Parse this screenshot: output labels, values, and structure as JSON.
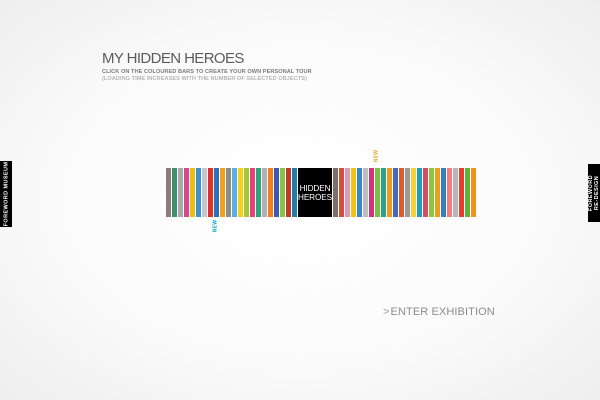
{
  "header": {
    "title": "MY HIDDEN HEROES",
    "subtitle": "CLICK ON THE COLOURED BARS TO CREATE YOUR OWN PERSONAL TOUR",
    "note": "(LOADING TIME INCREASES WITH THE NUMBER OF SELECTED OBJECTS)"
  },
  "side_tabs": {
    "left": "FOREWORD MUSEUM",
    "right": "FOREWORD\nRE-DESIGN"
  },
  "barcode": {
    "center_line1": "HIDDEN",
    "center_line2": "HEROES",
    "left_bars": [
      "#8a7c76",
      "#3f8f6e",
      "#a9a9a9",
      "#d24b8c",
      "#e8bf16",
      "#3f8fcf",
      "#c7c7c7",
      "#e0302a",
      "#2f6fb8",
      "#f0a11e",
      "#8c8c8c",
      "#5aaee0",
      "#f2d21a",
      "#a4c83a",
      "#e3457b",
      "#2ea47d",
      "#b0b0b0",
      "#f07e22",
      "#3a5bab",
      "#87c447",
      "#c0392b",
      "#1f7fa8"
    ],
    "right_bars": [
      "#7a6f6a",
      "#d94b3a",
      "#e09ab8",
      "#f2c414",
      "#3a86c9",
      "#bdbdbd",
      "#d7307f",
      "#7dbf3f",
      "#2f9f8f",
      "#ef9a1c",
      "#4a6ab0",
      "#e15a2a",
      "#9a9a9a",
      "#f4d23b",
      "#1f9fb7",
      "#d64a6a",
      "#8ec641",
      "#e5a31f",
      "#3d7cc1",
      "#f07c80",
      "#b7b7b7",
      "#e63c2f",
      "#5fb043",
      "#f0931c"
    ]
  },
  "new_tags": {
    "top": "NEW",
    "bottom": "NEW"
  },
  "enter": {
    "arrow": ">",
    "label": "ENTER EXHIBITION"
  }
}
